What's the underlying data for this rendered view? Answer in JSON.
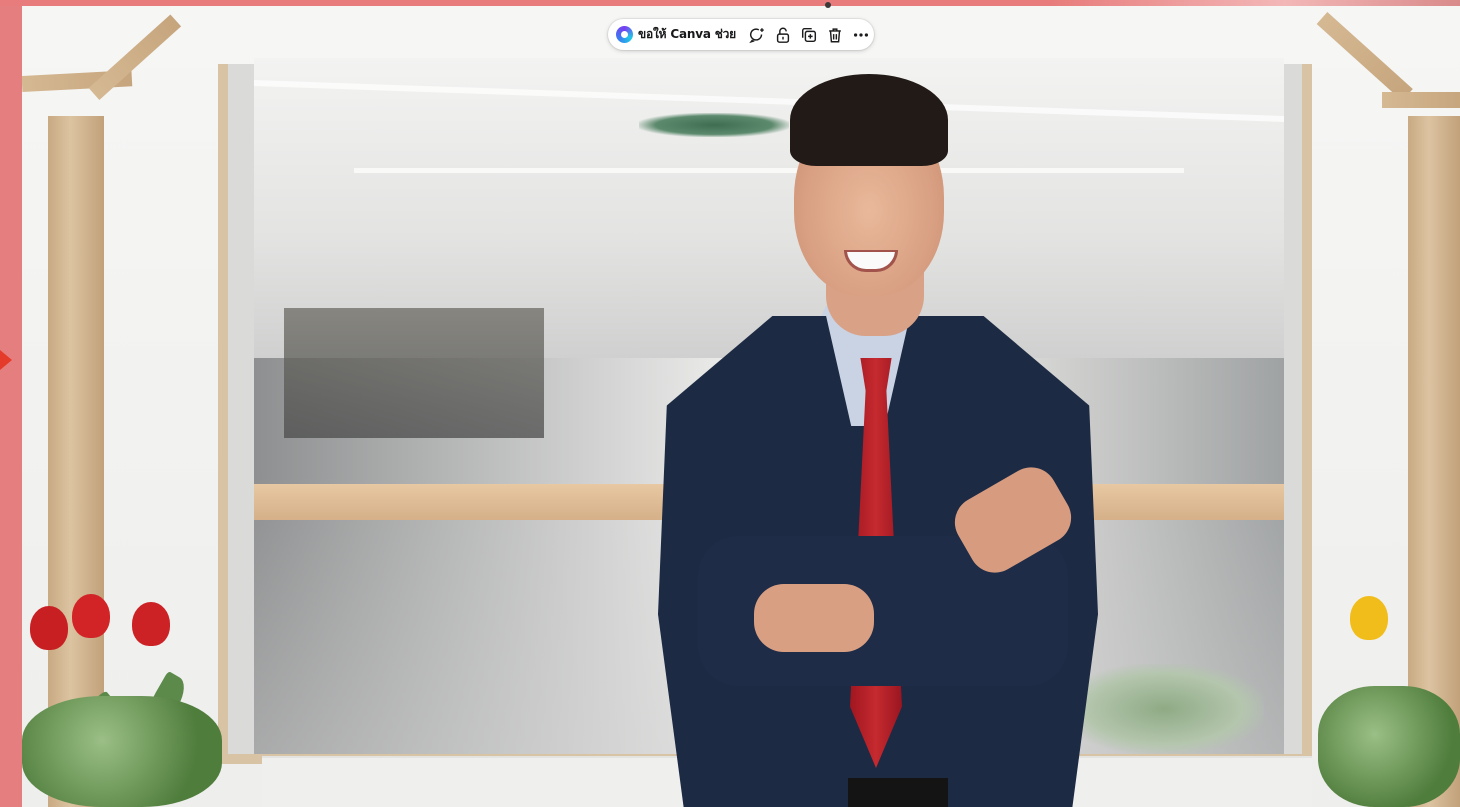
{
  "toolbar": {
    "ask_canva_label": "ขอให้ Canva ช่วย",
    "icons": [
      "canva-ai-icon",
      "comment-add-icon",
      "lock-icon",
      "duplicate-icon",
      "delete-icon",
      "more-icon"
    ]
  },
  "colors": {
    "background": "#e57f7f",
    "toolbar_bg": "#ffffff",
    "jacket": "#1d2a44",
    "tie": "#c52a2f"
  }
}
